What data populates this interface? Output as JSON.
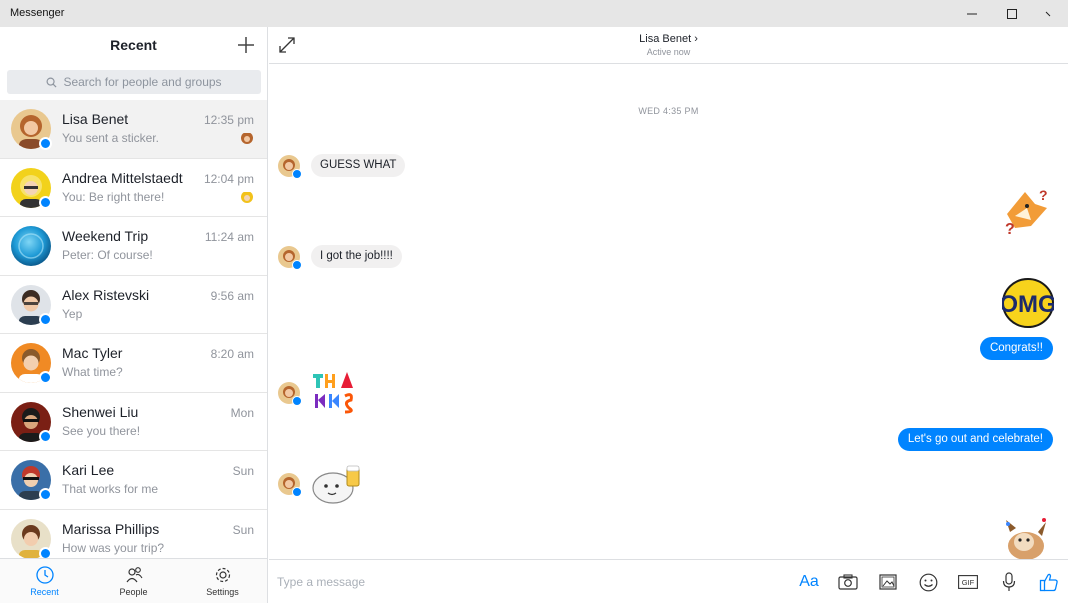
{
  "window": {
    "title": "Messenger"
  },
  "sidebar": {
    "title": "Recent",
    "search_placeholder": "Search for people and groups",
    "conversations": [
      {
        "name": "Lisa Benet",
        "preview": "You sent a sticker.",
        "time": "12:35 pm",
        "avatar_color": "#c98a4b"
      },
      {
        "name": "Andrea Mittelstaedt",
        "preview": "You: Be right there!",
        "time": "12:04 pm",
        "avatar_color": "#f2c21b"
      },
      {
        "name": "Weekend Trip",
        "preview": "Peter: Of course!",
        "time": "11:24 am",
        "avatar_color": "#1e9ad6"
      },
      {
        "name": "Alex Ristevski",
        "preview": "Yep",
        "time": "9:56 am",
        "avatar_color": "#7d8a96"
      },
      {
        "name": "Mac Tyler",
        "preview": "What time?",
        "time": "8:20 am",
        "avatar_color": "#f08a24"
      },
      {
        "name": "Shenwei Liu",
        "preview": "See you there!",
        "time": "Mon",
        "avatar_color": "#8b2a1c"
      },
      {
        "name": "Kari Lee",
        "preview": "That works for me",
        "time": "Sun",
        "avatar_color": "#3a6fa8"
      },
      {
        "name": "Marissa Phillips",
        "preview": "How was your trip?",
        "time": "Sun",
        "avatar_color": "#e0b23c"
      }
    ],
    "nav": [
      {
        "label": "Recent",
        "icon": "clock-icon"
      },
      {
        "label": "People",
        "icon": "people-icon"
      },
      {
        "label": "Settings",
        "icon": "gear-icon"
      }
    ]
  },
  "chat": {
    "contact_name": "Lisa Benet",
    "contact_status": "Active now",
    "date_stamp": "WED 4:35 PM",
    "messages": [
      {
        "from": "them",
        "type": "text",
        "text": "GUESS WHAT"
      },
      {
        "from": "me",
        "type": "sticker",
        "sticker": "confused-fox-sticker"
      },
      {
        "from": "them",
        "type": "text",
        "text": "I got the job!!!!"
      },
      {
        "from": "me",
        "type": "sticker",
        "sticker": "omg-sticker"
      },
      {
        "from": "me",
        "type": "text",
        "text": "Congrats!!"
      },
      {
        "from": "them",
        "type": "sticker",
        "sticker": "thanks-sticker"
      },
      {
        "from": "me",
        "type": "text",
        "text": "Let's go out and celebrate!"
      },
      {
        "from": "them",
        "type": "sticker",
        "sticker": "cheers-sticker"
      },
      {
        "from": "me",
        "type": "sticker",
        "sticker": "party-dog-sticker"
      }
    ],
    "omg_text": "OMG",
    "composer_placeholder": "Type a message",
    "font_button": "Aa"
  },
  "colors": {
    "accent": "#0084ff",
    "bubble_in": "#f1f0f0",
    "titlebar": "#e6e6e6"
  }
}
